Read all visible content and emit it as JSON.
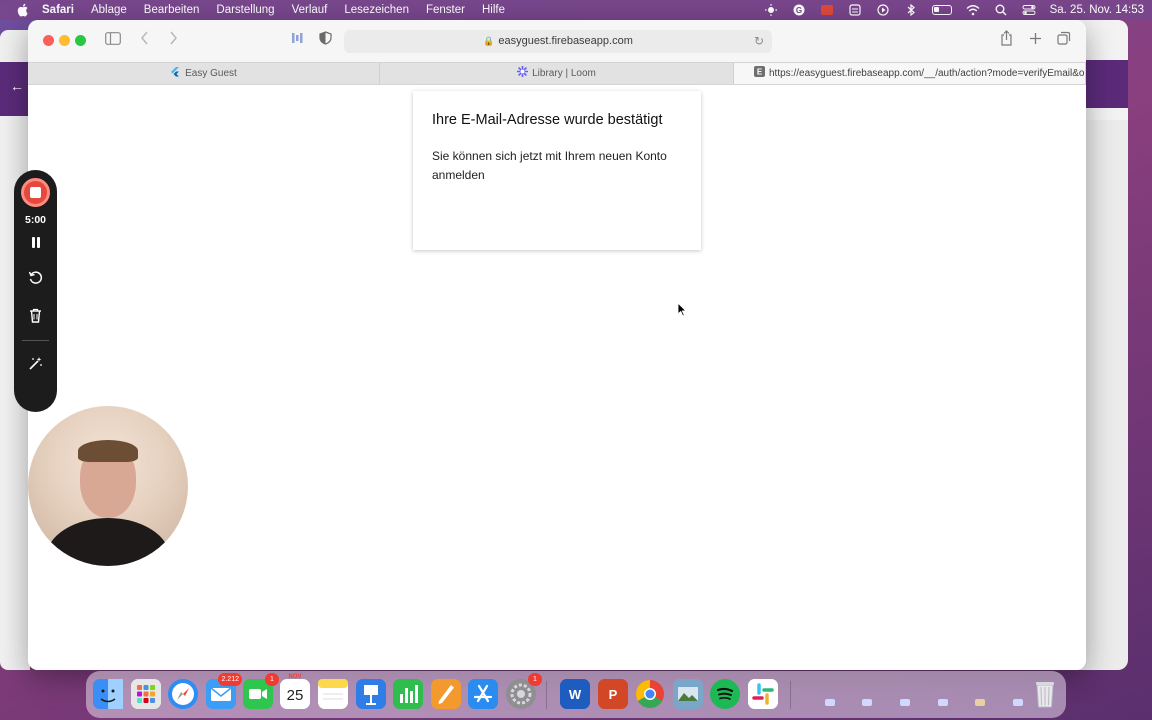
{
  "menubar": {
    "app_name": "Safari",
    "items": [
      "Ablage",
      "Bearbeiten",
      "Darstellung",
      "Verlauf",
      "Lesezeichen",
      "Fenster",
      "Hilfe"
    ],
    "clock": "Sa. 25. Nov. 14:53",
    "status_icons": [
      "brightness-icon",
      "g-icon",
      "app-icon",
      "clipboard-icon",
      "play-icon",
      "bluetooth-icon",
      "battery-icon",
      "wifi-icon",
      "search-icon",
      "control-center-icon"
    ]
  },
  "browser": {
    "url_display": "easyguest.firebaseapp.com",
    "tabs": [
      {
        "label": "Easy Guest",
        "icon": "flutter-icon",
        "active": false
      },
      {
        "label": "Library | Loom",
        "icon": "loom-icon",
        "active": false
      },
      {
        "label": "https://easyguest.firebaseapp.com/__/auth/action?mode=verifyEmail&o...",
        "icon": "e-icon",
        "active": true
      }
    ]
  },
  "page": {
    "card_title": "Ihre E-Mail-Adresse wurde bestätigt",
    "card_body": "Sie können sich jetzt mit Ihrem neuen Konto anmelden"
  },
  "loom": {
    "timer": "5:00",
    "controls": [
      "stop-recording-button",
      "pause-button",
      "restart-button",
      "delete-button",
      "effects-button"
    ]
  },
  "dock": {
    "apps": [
      {
        "name": "finder-icon",
        "color": "#3a8ef6"
      },
      {
        "name": "launchpad-icon",
        "color": "#e7e7e7"
      },
      {
        "name": "safari-icon",
        "color": "#2b8df5"
      },
      {
        "name": "mail-icon",
        "color": "#3b9df6",
        "badge": "2.212"
      },
      {
        "name": "facetime-icon",
        "color": "#2fc64f",
        "badge": "1"
      },
      {
        "name": "calendar-icon",
        "color": "#ffffff",
        "day": "25",
        "month": "NOV"
      },
      {
        "name": "notes-icon",
        "color": "#fbe26b"
      },
      {
        "name": "keynote-icon",
        "color": "#2f7de6"
      },
      {
        "name": "numbers-icon",
        "color": "#2fbe4d"
      },
      {
        "name": "pages-icon",
        "color": "#f29a2e"
      },
      {
        "name": "app-store-icon",
        "color": "#2a8cf0"
      },
      {
        "name": "system-settings-icon",
        "color": "#8e8e93",
        "badge": "1"
      },
      {
        "name": "word-icon",
        "color": "#1e5dbf"
      },
      {
        "name": "powerpoint-icon",
        "color": "#d24726"
      },
      {
        "name": "chrome-icon",
        "color": "#ea4335"
      },
      {
        "name": "preview-icon",
        "color": "#7aa7c9"
      },
      {
        "name": "spotify-icon",
        "color": "#1db954"
      },
      {
        "name": "slack-icon",
        "color": "#ffffff"
      }
    ]
  }
}
